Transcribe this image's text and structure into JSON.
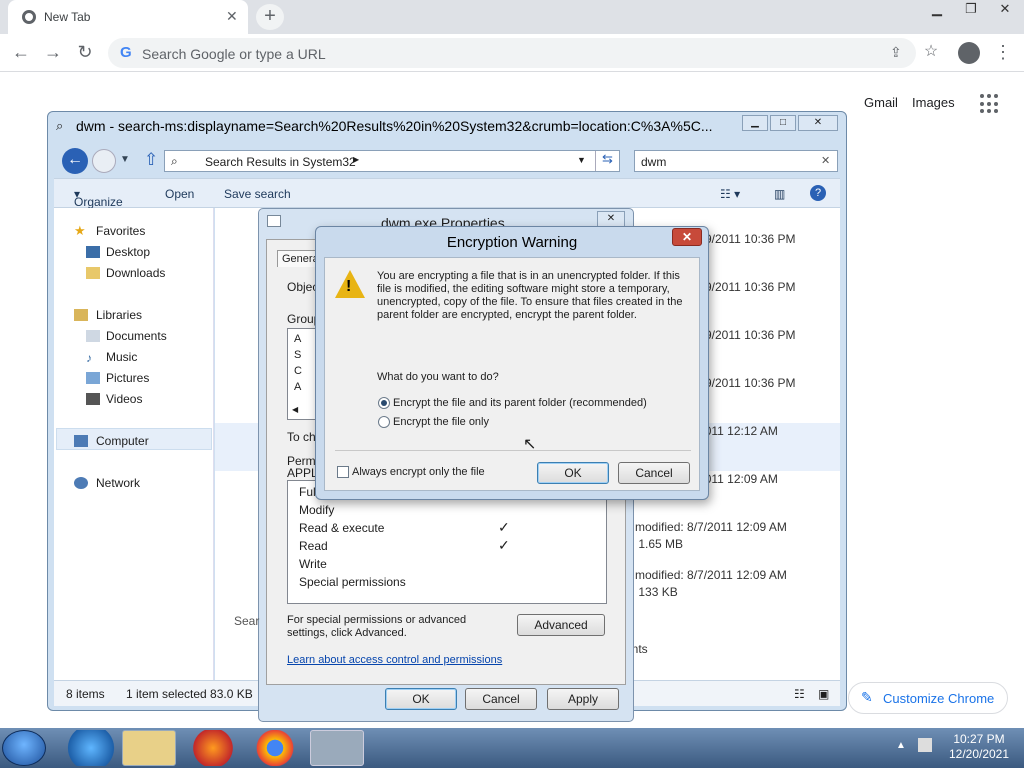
{
  "chrome": {
    "tab_title": "New Tab",
    "omnibox_placeholder": "Search Google or type a URL",
    "gmail": "Gmail",
    "images": "Images",
    "customize": "Customize Chrome"
  },
  "explorer": {
    "title": "dwm - search-ms:displayname=Search%20Results%20in%20System32&crumb=location:C%3A%5C...",
    "address": "Search Results in System32",
    "search_value": "dwm",
    "toolbar": {
      "organize": "Organize",
      "open": "Open",
      "save_search": "Save search"
    },
    "nav": {
      "favorites": "Favorites",
      "desktop": "Desktop",
      "downloads": "Downloads",
      "libraries": "Libraries",
      "documents": "Documents",
      "music": "Music",
      "pictures": "Pictures",
      "videos": "Videos",
      "computer": "Computer",
      "network": "Network"
    },
    "rows": [
      "9/2011 10:36 PM",
      "9/2011 10:36 PM",
      "9/2011 10:36 PM",
      "9/2011 10:36 PM",
      "8/7/2011 12:12 AM",
      "8/7/2011 12:09 AM",
      "e modified: 8/7/2011 12:09 AM",
      "e: 1.65 MB",
      "e modified: 8/7/2011 12:09 AM",
      "e: 133 KB",
      "ents"
    ],
    "status": {
      "count": "8 items",
      "selected": "1 item selected  83.0 KB"
    }
  },
  "props": {
    "title": "dwm.exe Properties",
    "tab_general": "Genera",
    "object": "Object",
    "group": "Group",
    "groups_partial": [
      "A",
      "S",
      "C",
      "A"
    ],
    "to_change": "To cha",
    "permis": "Permis",
    "appli": "APPLI",
    "perms": [
      "Full",
      "Modify",
      "Read & execute",
      "Read",
      "Write",
      "Special permissions"
    ],
    "checks": [
      "",
      "",
      "✓",
      "✓",
      "",
      ""
    ],
    "special_note": "For special permissions or advanced settings, click Advanced.",
    "advanced": "Advanced",
    "learn_link": "Learn about access control and permissions",
    "search_partial": "Sear",
    "ok": "OK",
    "cancel": "Cancel",
    "apply": "Apply"
  },
  "encryption": {
    "title": "Encryption Warning",
    "message": "You are encrypting a file that is in an unencrypted folder. If this file is modified, the editing software might store a temporary, unencrypted, copy of the file. To ensure that files created in the parent folder are encrypted, encrypt the parent folder.",
    "question": "What do you want to do?",
    "option1": "Encrypt the file and its parent folder (recommended)",
    "option2": "Encrypt the file only",
    "always": "Always encrypt only the file",
    "ok": "OK",
    "cancel": "Cancel"
  },
  "taskbar": {
    "time": "10:27 PM",
    "date": "12/20/2021"
  },
  "colors": {
    "chrome_accent": "#1a73e8",
    "win_frame": "#cfe0f1",
    "warning": "#e8b414",
    "close_red": "#c74a3a"
  }
}
